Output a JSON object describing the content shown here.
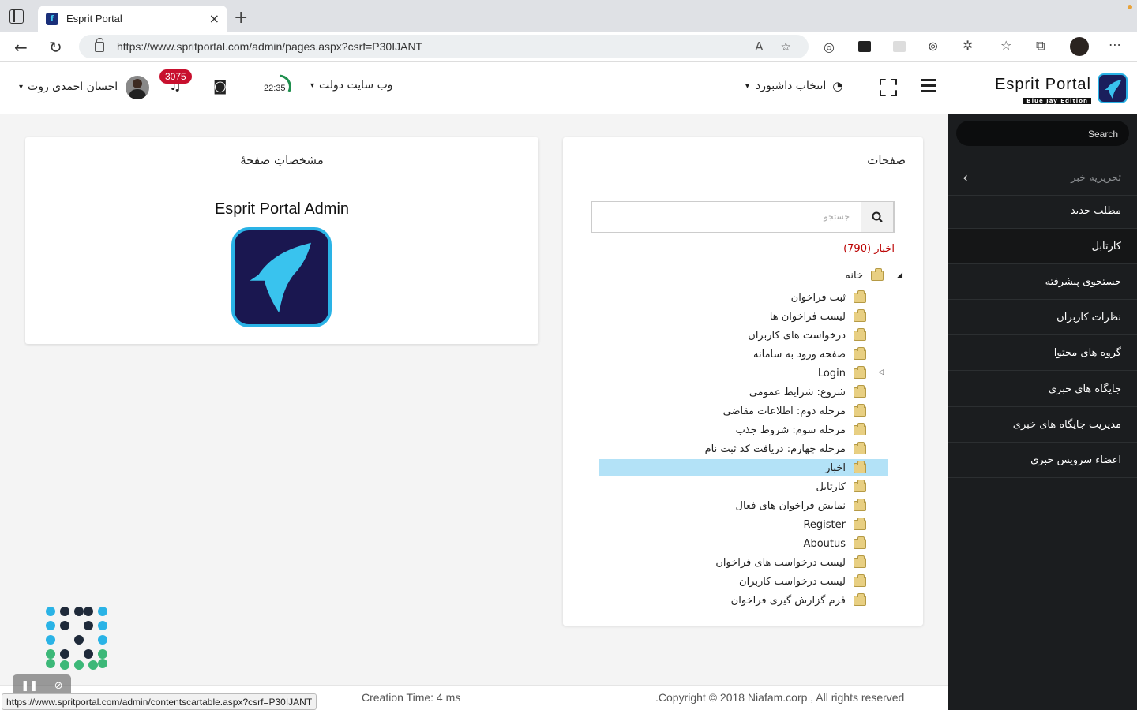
{
  "browser": {
    "tab_title": "Esprit Portal",
    "tab_favicon_letter": "f",
    "tab_close": "×",
    "new_tab": "+",
    "url": "https://www.spritportal.com/admin/pages.aspx?csrf=P30IJANT",
    "back": "←",
    "reload": "↻"
  },
  "header": {
    "logo_title": "Esprit Portal",
    "logo_subtitle": "Blue Jay Edition",
    "dashboard_select": "انتخاب داشبورد",
    "site_select": "وب سایت دولت",
    "timer": "22:35",
    "notifications": "3075",
    "user_name": "احسان احمدی روت",
    "caret": "▾"
  },
  "sidebar": {
    "search_placeholder": "Search",
    "items": [
      {
        "label": "تحریریه خبر",
        "chevron": "›"
      },
      {
        "label": "مطلب جدید"
      },
      {
        "label": "کارتابل"
      },
      {
        "label": "جستجوی پیشرفته"
      },
      {
        "label": "نظرات کاربران"
      },
      {
        "label": "گروه های محتوا"
      },
      {
        "label": "جایگاه های خبری"
      },
      {
        "label": "مدیریت جایگاه های خبری"
      },
      {
        "label": "اعضاء سرویس خبری"
      }
    ]
  },
  "pages_panel": {
    "title": "صفحات",
    "search_placeholder": "جستجو",
    "news_count": "اخبار (790)",
    "root": "خانه",
    "root_arrow": "◢",
    "login_arrow": "◁",
    "items": [
      "ثبت فراخوان",
      "لیست فراخوان ها",
      "درخواست های کاربران",
      "صفحه ورود به سامانه",
      "Login",
      "شروع: شرایط عمومی",
      "مرحله دوم: اطلاعات مقاضی",
      "مرحله سوم: شروط جذب",
      "مرحله چهارم: دریافت کد ثبت نام",
      "اخبار",
      "کارتابل",
      "نمایش فراخوان های فعال",
      "Register",
      "Aboutus",
      "لیست درخواست های فراخوان",
      "لیست درخواست کاربران",
      "فرم گزارش گیری فراخوان"
    ],
    "selected_index": 9
  },
  "props_panel": {
    "title": "مشخصاتِ صفحهٔ",
    "app_title": "Esprit Portal Admin"
  },
  "footer": {
    "creation_time": "Creation Time: 4 ms",
    "copyright": ".Copyright © 2018 Niafam.corp , All rights reserved",
    "status_url": "https://www.spritportal.com/admin/contentscartable.aspx?csrf=P30IJANT"
  },
  "colors": {
    "sidebar_bg": "#1b1d1f",
    "accent_blue": "#2ab3e6",
    "badge_red": "#c8102e",
    "selection": "#b3e2f7",
    "news_count": "#bb0000"
  }
}
